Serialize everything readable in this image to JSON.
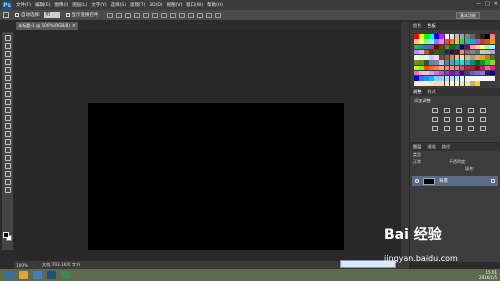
{
  "menubar": {
    "logo": "Ps",
    "items": [
      "文件(F)",
      "编辑(E)",
      "图像(I)",
      "图层(L)",
      "文字(Y)",
      "选择(S)",
      "滤镜(T)",
      "3D(D)",
      "视图(V)",
      "窗口(W)",
      "帮助(H)"
    ],
    "controls": [
      "—",
      "□",
      "✕"
    ]
  },
  "options": {
    "auto_select_label": "自动选择:",
    "auto_select_value": "组",
    "show_transform_label": "显示变换控件",
    "workspace_label": "基本功能"
  },
  "doc_tab": {
    "title": "未标题-1 @ 100%(RGB/8)",
    "close": "×"
  },
  "status": {
    "zoom": "100%",
    "doc_info": "文档:703.1K/0 字节"
  },
  "panels": {
    "swatch_tabs": [
      "颜色",
      "色板"
    ],
    "adjust_tabs": [
      "调整",
      "样式"
    ],
    "adjust_title": "添加调整",
    "layer_tabs": [
      "图层",
      "通道",
      "路径"
    ],
    "layer_kind": "类型",
    "layer_mode": "正常",
    "layer_opacity_label": "不透明度:",
    "layer_fill_label": "填充:",
    "layer_name": "背景"
  },
  "watermark": {
    "brand": "Bai 经验",
    "url": "jingyan.baidu.com"
  },
  "tray": {
    "time": "15:01",
    "date": "2016/1/5"
  },
  "swatch_colors": [
    "#ff0000",
    "#ffff00",
    "#00ff00",
    "#00ffff",
    "#0000ff",
    "#ff00ff",
    "#ffffff",
    "#e0e0e0",
    "#c0c0c0",
    "#a0a0a0",
    "#808080",
    "#606060",
    "#404040",
    "#202020",
    "#000000",
    "#ff7f7f",
    "#ffbf7f",
    "#ffff7f",
    "#7fff7f",
    "#7fffff",
    "#7f7fff",
    "#ff7fff",
    "#e74c3c",
    "#e67e22",
    "#f1c40f",
    "#2ecc71",
    "#1abc9c",
    "#3498db",
    "#9b59b6",
    "#c0392b",
    "#d35400",
    "#f39c12",
    "#27ae60",
    "#16a085",
    "#2980b9",
    "#8e44ad",
    "#7f0000",
    "#7f3f00",
    "#7f7f00",
    "#007f00",
    "#007f7f",
    "#00007f",
    "#7f007f",
    "#ff9999",
    "#ffcc99",
    "#ffff99",
    "#99ff99",
    "#99ffff",
    "#9999ff",
    "#ff99ff",
    "#996633",
    "#663300",
    "#336600",
    "#006633",
    "#003366",
    "#330066",
    "#660033",
    "#cc9966",
    "#996666",
    "#669966",
    "#666699",
    "#cccc99",
    "#99cccc",
    "#cc99cc",
    "#ffffcc",
    "#ccffcc",
    "#ccffff",
    "#ccccff",
    "#ffccff",
    "#8b4513",
    "#a0522d",
    "#cd853f",
    "#deb887",
    "#f5deb3",
    "#d2b48c",
    "#bc8f8f",
    "#f4a460",
    "#daa520",
    "#b8860b",
    "#556b2f",
    "#6b8e23",
    "#808000",
    "#2f4f4f",
    "#708090",
    "#778899",
    "#b0c4de",
    "#4682b4",
    "#5f9ea0",
    "#00ced1",
    "#48d1cc",
    "#20b2aa",
    "#008b8b",
    "#006400",
    "#228b22",
    "#32cd32",
    "#9acd32",
    "#adff2f",
    "#7cfc00",
    "#ff4500",
    "#ff6347",
    "#ff7f50",
    "#ffa07a",
    "#fa8072",
    "#e9967a",
    "#f08080",
    "#cd5c5c",
    "#dc143c",
    "#b22222",
    "#8b0000",
    "#c71585",
    "#db7093",
    "#ff1493",
    "#ff69b4",
    "#ffb6c1",
    "#ffc0cb",
    "#dda0dd",
    "#da70d6",
    "#ba55d3",
    "#9932cc",
    "#9400d3",
    "#8a2be2",
    "#4b0082",
    "#483d8b",
    "#6a5acd",
    "#7b68ee",
    "#9370db",
    "#191970",
    "#000080",
    "#0000cd",
    "#4169e1",
    "#1e90ff",
    "#00bfff",
    "#87ceeb",
    "#87cefa",
    "#add8e6",
    "#b0e0e6",
    "#afeeee",
    "#e0ffff",
    "#f0f8ff",
    "#f0fff0",
    "#f5fffa",
    "#fffafa",
    "#fff5ee",
    "#fdf5e6",
    "#faf0e6",
    "#ffefd5",
    "#ffebcd",
    "#ffe4c4",
    "#ffdab9",
    "#ffdead",
    "#ffe4b5",
    "#fffacd",
    "#fafad2",
    "#eee8aa",
    "#f0e68c",
    "#bdb76b",
    "#ffd700"
  ]
}
